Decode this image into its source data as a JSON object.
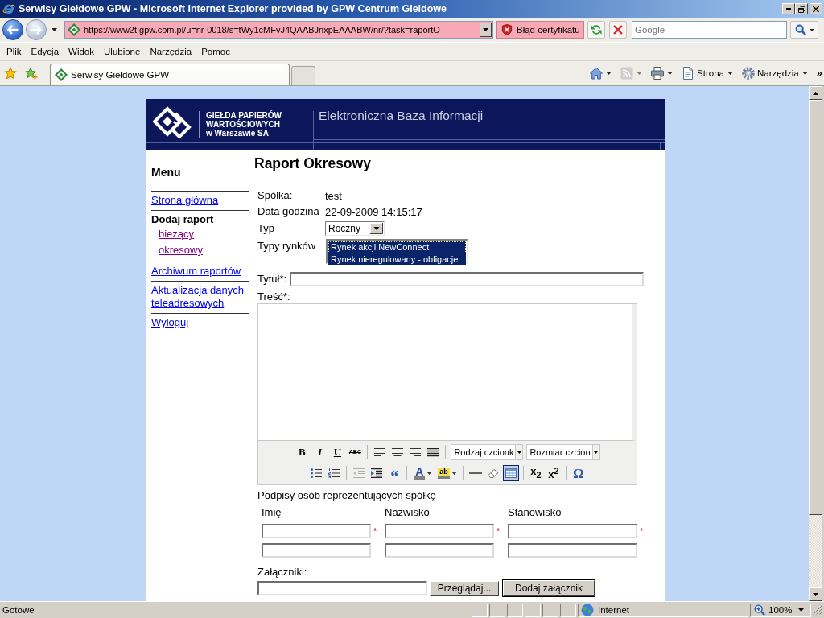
{
  "window": {
    "title": "Serwisy Giełdowe GPW - Microsoft Internet Explorer provided by GPW Centrum Gieldowe"
  },
  "address_bar": {
    "back_enabled": true,
    "forward_enabled": false,
    "url": "https://www2t.gpw.com.pl/u=nr-0018/s=tWy1cMFvJ4QAABJnxpEAAABW/nr/?task=raportO",
    "certificate_error": "Błąd certyfikatu"
  },
  "search": {
    "placeholder": "Google"
  },
  "menu_bar": [
    "Plik",
    "Edycja",
    "Widok",
    "Ulubione",
    "Narzędzia",
    "Pomoc"
  ],
  "tabs": [
    {
      "label": "Serwisy Giełdowe GPW",
      "selected": true
    }
  ],
  "command_bar": {
    "items": [
      {
        "kind": "home",
        "disabled": false
      },
      {
        "kind": "feeds",
        "disabled": true
      },
      {
        "kind": "print",
        "disabled": false
      },
      {
        "kind": "page",
        "label": "Strona",
        "disabled": false
      },
      {
        "kind": "tools",
        "label": "Narzędzia",
        "disabled": false
      }
    ],
    "overflow": "»"
  },
  "page": {
    "logo": {
      "lines": [
        "GIEŁDA PAPIERÓW",
        "WARTOŚCIOWYCH",
        "w Warszawie SA"
      ]
    },
    "header_title": "Elektroniczna Baza Informacji",
    "sidebar": {
      "title": "Menu",
      "items": [
        {
          "label": "Strona główna",
          "kind": "link",
          "visited": false
        },
        {
          "label": "Dodaj raport",
          "kind": "heading",
          "children": [
            {
              "label": "bieżący",
              "visited": true
            },
            {
              "label": "okresowy",
              "visited": true
            }
          ]
        },
        {
          "label": "Archiwum raportów",
          "kind": "link",
          "visited": false
        },
        {
          "label": "Aktualizacja danych teleadresowych",
          "kind": "link",
          "visited": false
        },
        {
          "label": "Wyloguj",
          "kind": "link",
          "visited": false
        }
      ]
    },
    "form": {
      "title": "Raport Okresowy",
      "info": [
        {
          "label": "Spółka:",
          "kind": "text",
          "value": "test"
        },
        {
          "label": "Data godzina",
          "kind": "text",
          "value": "22-09-2009 14:15:17"
        },
        {
          "label": "Typ",
          "kind": "select",
          "value": "Roczny"
        },
        {
          "label": "Typy rynków",
          "kind": "listbox",
          "options": [
            {
              "label": "Rynek akcji NewConnect",
              "selected": true,
              "focused": true
            },
            {
              "label": "Rynek nieregulowany - obligacje",
              "selected": true,
              "focused": false
            }
          ]
        }
      ],
      "title_field": {
        "label": "Tytuł*:"
      },
      "body_field": {
        "label": "Treść*:"
      },
      "editor_toolbar": [
        [
          {
            "kind": "bold",
            "glyph": "B",
            "active": false,
            "disabled": false
          },
          {
            "kind": "italic",
            "glyph": "I",
            "active": false,
            "disabled": false
          },
          {
            "kind": "underline",
            "glyph": "U",
            "active": false,
            "disabled": false
          },
          {
            "kind": "strike",
            "glyph": "ABC",
            "active": false,
            "disabled": false
          },
          {
            "kind": "separator"
          },
          {
            "kind": "align-left",
            "active": false,
            "disabled": false
          },
          {
            "kind": "align-center",
            "active": false,
            "disabled": false
          },
          {
            "kind": "align-right",
            "active": false,
            "disabled": false
          },
          {
            "kind": "justify",
            "active": false,
            "disabled": false
          },
          {
            "kind": "separator"
          },
          {
            "kind": "dropdown",
            "label": "Rodzaj czcionk"
          },
          {
            "kind": "dropdown",
            "label": "Rozmiar czcion"
          }
        ],
        [
          {
            "kind": "bullets",
            "active": false,
            "disabled": false
          },
          {
            "kind": "numbers",
            "active": false,
            "disabled": false
          },
          {
            "kind": "separator"
          },
          {
            "kind": "outdent",
            "active": false,
            "disabled": true
          },
          {
            "kind": "indent",
            "active": false,
            "disabled": false
          },
          {
            "kind": "quote",
            "glyph": "“",
            "active": false,
            "disabled": false
          },
          {
            "kind": "separator"
          },
          {
            "kind": "text-color",
            "glyph": "A",
            "active": false,
            "disabled": false
          },
          {
            "kind": "highlight",
            "glyph": "ab",
            "active": false,
            "disabled": false
          },
          {
            "kind": "separator"
          },
          {
            "kind": "rule",
            "active": false,
            "disabled": false
          },
          {
            "kind": "eraser",
            "active": false,
            "disabled": false
          },
          {
            "kind": "table",
            "active": true,
            "disabled": false
          },
          {
            "kind": "separator"
          },
          {
            "kind": "subscript",
            "glyph": "x$_{2}$",
            "active": false,
            "disabled": false
          },
          {
            "kind": "superscript",
            "glyph": "x$^{2}$",
            "active": false,
            "disabled": false
          },
          {
            "kind": "separator"
          },
          {
            "kind": "symbol",
            "glyph": "Ω",
            "active": false,
            "disabled": false
          }
        ]
      ],
      "signatures": {
        "title": "Podpisy osób reprezentujących spółkę",
        "columns": [
          "Imię",
          "Nazwisko",
          "Stanowisko"
        ],
        "required_mark": "*",
        "rows": [
          {
            "kind": "required"
          },
          {
            "kind": "optional"
          }
        ]
      },
      "attachments": {
        "label": "Załączniki:",
        "browse_button": "Przeglądaj...",
        "add_button": "Dodaj załącznik"
      }
    }
  },
  "status_bar": {
    "text": "Gotowe",
    "zone": "Internet",
    "zoom": "100%"
  }
}
